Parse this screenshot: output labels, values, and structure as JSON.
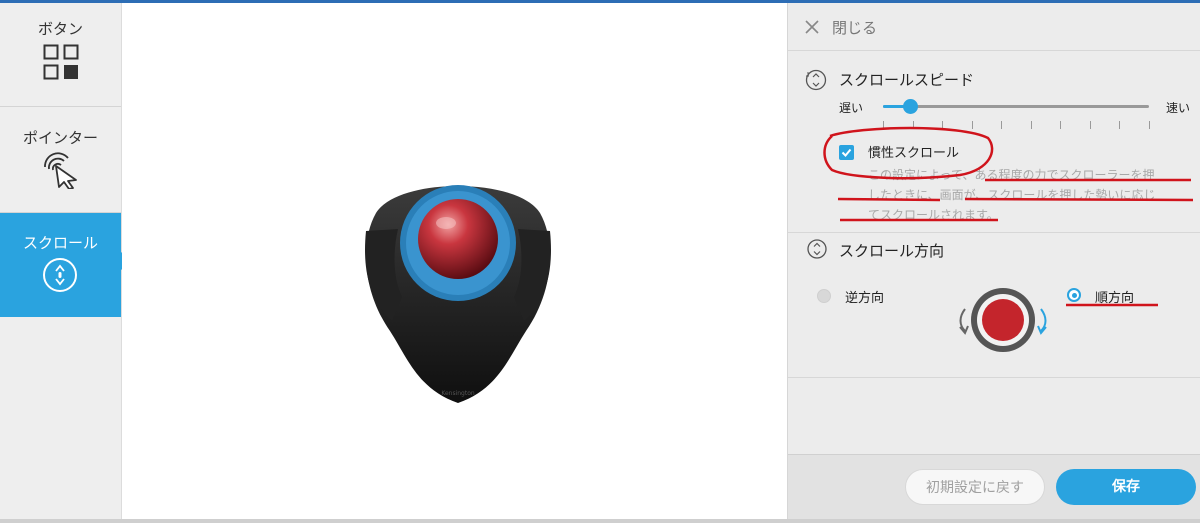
{
  "nav": {
    "button_label": "ボタン",
    "pointer_label": "ポインター",
    "scroll_label": "スクロール"
  },
  "panel": {
    "close_label": "閉じる",
    "scroll_speed": {
      "title": "スクロールスピード",
      "slow_label": "遅い",
      "fast_label": "速い",
      "value": 0.1,
      "tick_count": 10
    },
    "inertia": {
      "label": "慣性スクロール",
      "checked": true,
      "desc_line1": "この設定によって、ある程度の力でスクローラーを押",
      "desc_line2": "したときに、画面が、スクロールを押した勢いに応じ",
      "desc_line3": "てスクロールされます。"
    },
    "direction": {
      "title": "スクロール方向",
      "reverse_label": "逆方向",
      "forward_label": "順方向",
      "selected": "forward"
    },
    "reset_label": "初期設定に戻す",
    "save_label": "保存"
  },
  "colors": {
    "accent": "#2aa3df",
    "annotation_red": "#d0141c"
  }
}
